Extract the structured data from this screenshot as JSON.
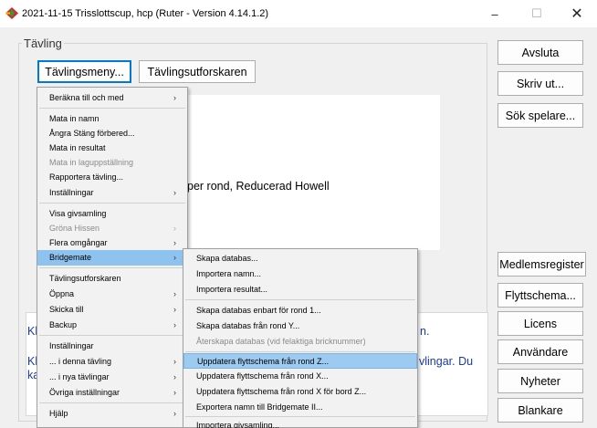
{
  "window": {
    "title": "2021-11-15 Trisslottscup, hcp  (Ruter - Version 4.14.1.2)",
    "minimize": "–",
    "maximize": "☐",
    "close": "✕",
    "icon": "ruter-app-icon"
  },
  "group": {
    "legend": "Tävling"
  },
  "top_buttons": [
    {
      "label": "Tävlingsmeny..."
    },
    {
      "label": "Tävlingsutforskaren"
    }
  ],
  "main_text": "per rond, Reducerad Howell",
  "right_buttons": [
    {
      "label": "Avsluta"
    },
    {
      "label": "Skriv ut..."
    },
    {
      "label": "Sök spelare..."
    },
    {
      "label": "Medlemsregister"
    },
    {
      "label": "Flyttschema..."
    },
    {
      "label": "Licens"
    },
    {
      "label": "Användare"
    },
    {
      "label": "Nyheter"
    },
    {
      "label": "Blankare"
    }
  ],
  "bottom_text": {
    "line1_left": "Klic",
    "line1_right": "n.",
    "line2_left": "Klic",
    "line2_right": "vlingar. Du",
    "line3_left": "kan"
  },
  "main_menu": {
    "items": [
      {
        "label": "Beräkna till och med",
        "submenu": true,
        "disabled": false
      },
      {
        "label": "Mata in namn",
        "submenu": false,
        "disabled": false
      },
      {
        "label": "Ångra Stäng förbered...",
        "submenu": false,
        "disabled": false
      },
      {
        "label": "Mata in resultat",
        "submenu": false,
        "disabled": false
      },
      {
        "label": "Mata in laguppställning",
        "submenu": false,
        "disabled": true
      },
      {
        "label": "Rapportera tävling...",
        "submenu": false,
        "disabled": false
      },
      {
        "label": "Inställningar",
        "submenu": true,
        "disabled": false
      },
      {
        "label": "Visa givsamling",
        "submenu": false,
        "disabled": false
      },
      {
        "label": "Gröna Hissen",
        "submenu": true,
        "disabled": true
      },
      {
        "label": "Flera omgångar",
        "submenu": true,
        "disabled": false
      },
      {
        "label": "Bridgemate",
        "submenu": true,
        "disabled": false,
        "highlight": true
      },
      {
        "label": "Tävlingsutforskaren",
        "submenu": false,
        "disabled": false
      },
      {
        "label": "Öppna",
        "submenu": true,
        "disabled": false
      },
      {
        "label": "Skicka till",
        "submenu": true,
        "disabled": false
      },
      {
        "label": "Backup",
        "submenu": true,
        "disabled": false
      },
      {
        "label": "Inställningar",
        "submenu": false,
        "disabled": false
      },
      {
        "label": "... i denna tävling",
        "submenu": true,
        "disabled": false
      },
      {
        "label": "... i nya tävlingar",
        "submenu": true,
        "disabled": false
      },
      {
        "label": "Övriga inställningar",
        "submenu": true,
        "disabled": false
      },
      {
        "label": "Hjälp",
        "submenu": true,
        "disabled": false
      }
    ]
  },
  "bridgemate_submenu": {
    "items": [
      {
        "label": "Skapa databas...",
        "disabled": false
      },
      {
        "label": "Importera namn...",
        "disabled": false
      },
      {
        "label": "Importera resultat...",
        "disabled": false
      },
      {
        "label": "Skapa databas enbart för rond 1...",
        "disabled": false
      },
      {
        "label": "Skapa databas från rond Y...",
        "disabled": false
      },
      {
        "label": "Återskapa databas (vid felaktiga bricknummer)",
        "disabled": true
      },
      {
        "label": "Uppdatera flyttschema från rond Z...",
        "disabled": false,
        "highlight": true
      },
      {
        "label": "Uppdatera flyttschema från rond X...",
        "disabled": false
      },
      {
        "label": "Uppdatera flyttschema från rond X för bord Z...",
        "disabled": false
      },
      {
        "label": "Exportera namn till Bridgemate II...",
        "disabled": false
      },
      {
        "label": "Importera givsamling...",
        "disabled": false
      }
    ]
  }
}
